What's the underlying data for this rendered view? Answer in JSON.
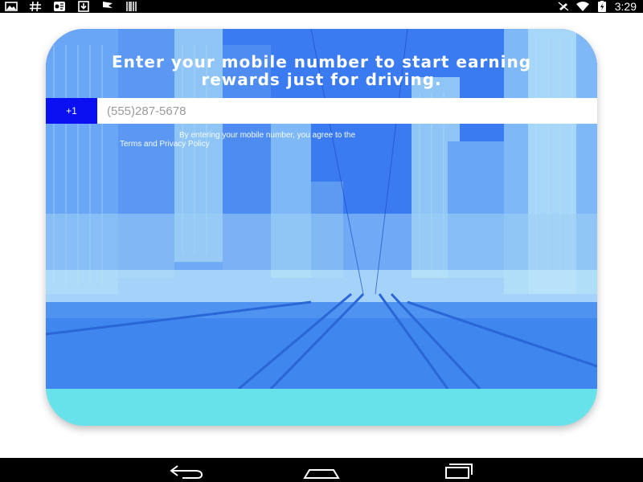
{
  "status_bar": {
    "left_icons": [
      "photo-icon",
      "hash-icon",
      "cast-icon",
      "download-icon",
      "flag-icon",
      "barcode-icon"
    ],
    "right_icons": [
      "mute-icon",
      "wifi-icon",
      "battery-icon"
    ],
    "time": "3:29"
  },
  "signup": {
    "headline_line1": "Enter your mobile number to start earning",
    "headline_line2": "rewards just for driving.",
    "country_code": "+1",
    "phone_placeholder": "(555)287-5678",
    "terms_line1": "By entering your mobile number, you agree to the",
    "terms_link": "Terms",
    "terms_and": "and",
    "privacy_link": "Privacy Policy"
  },
  "nav_bar": {
    "buttons": [
      "back-icon",
      "home-icon",
      "recents-icon"
    ]
  },
  "colors": {
    "hero_blue": "#3a78f0",
    "country_button": "#0a10f2",
    "card_bottom": "#67e1ea"
  }
}
